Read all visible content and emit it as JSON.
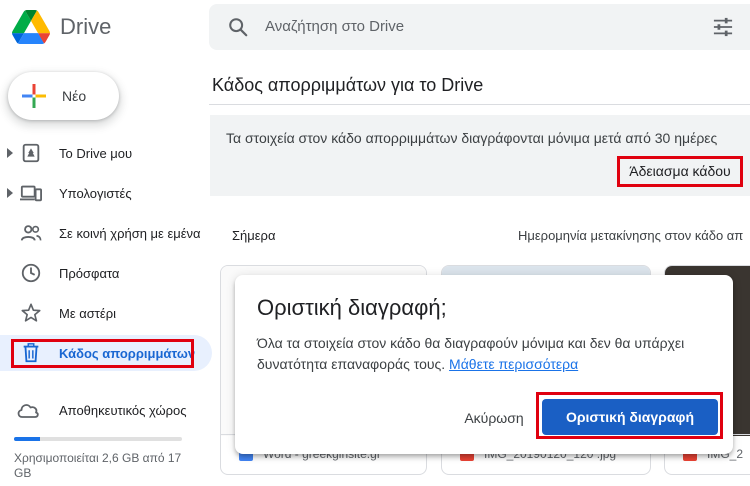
{
  "app": {
    "name": "Drive"
  },
  "search": {
    "placeholder": "Αναζήτηση στο Drive"
  },
  "sidebar": {
    "new_label": "Νέο",
    "items": [
      {
        "label": "Το Drive μου",
        "icon": "drive-icon"
      },
      {
        "label": "Υπολογιστές",
        "icon": "computer-icon"
      },
      {
        "label": "Σε κοινή χρήση με εμένα",
        "icon": "people-icon"
      },
      {
        "label": "Πρόσφατα",
        "icon": "clock-icon"
      },
      {
        "label": "Με αστέρι",
        "icon": "star-icon"
      },
      {
        "label": "Κάδος απορριμμάτων",
        "icon": "trash-icon"
      }
    ],
    "storage": {
      "label": "Αποθηκευτικός χώρος",
      "usage_text": "Χρησιμοποιείται 2,6 GB από 17 GB",
      "used_fraction": 0.153
    }
  },
  "main": {
    "title": "Κάδος απορριμμάτων για το Drive",
    "banner_text": "Τα στοιχεία στον κάδο απορριμμάτων διαγράφονται μόνιμα μετά από 30 ημέρες",
    "empty_trash_label": "Άδειασμα κάδου",
    "section_label": "Σήμερα",
    "sort_label": "Ημερομηνία μετακίνησης στον κάδο απ",
    "files": [
      {
        "name": "Word - greekgirlsite.gr",
        "type_color": "#4285f4"
      },
      {
        "name": "IMG_20190120_120 .jpg",
        "type_color": "#ea4335"
      },
      {
        "name": "IMG_2",
        "type_color": "#ea4335"
      }
    ]
  },
  "dialog": {
    "title": "Οριστική διαγραφή;",
    "body": "Όλα τα στοιχεία στον κάδο θα διαγραφούν μόνιμα και δεν θα υπάρχει δυνατότητα επαναφοράς τους.",
    "link": "Μάθετε περισσότερα",
    "cancel_label": "Ακύρωση",
    "confirm_label": "Οριστική διαγραφή"
  },
  "colors": {
    "accent": "#1a73e8",
    "active_nav_bg": "#e8f0fe",
    "highlight": "#e0000f",
    "confirm_button": "#1a5fc4"
  }
}
